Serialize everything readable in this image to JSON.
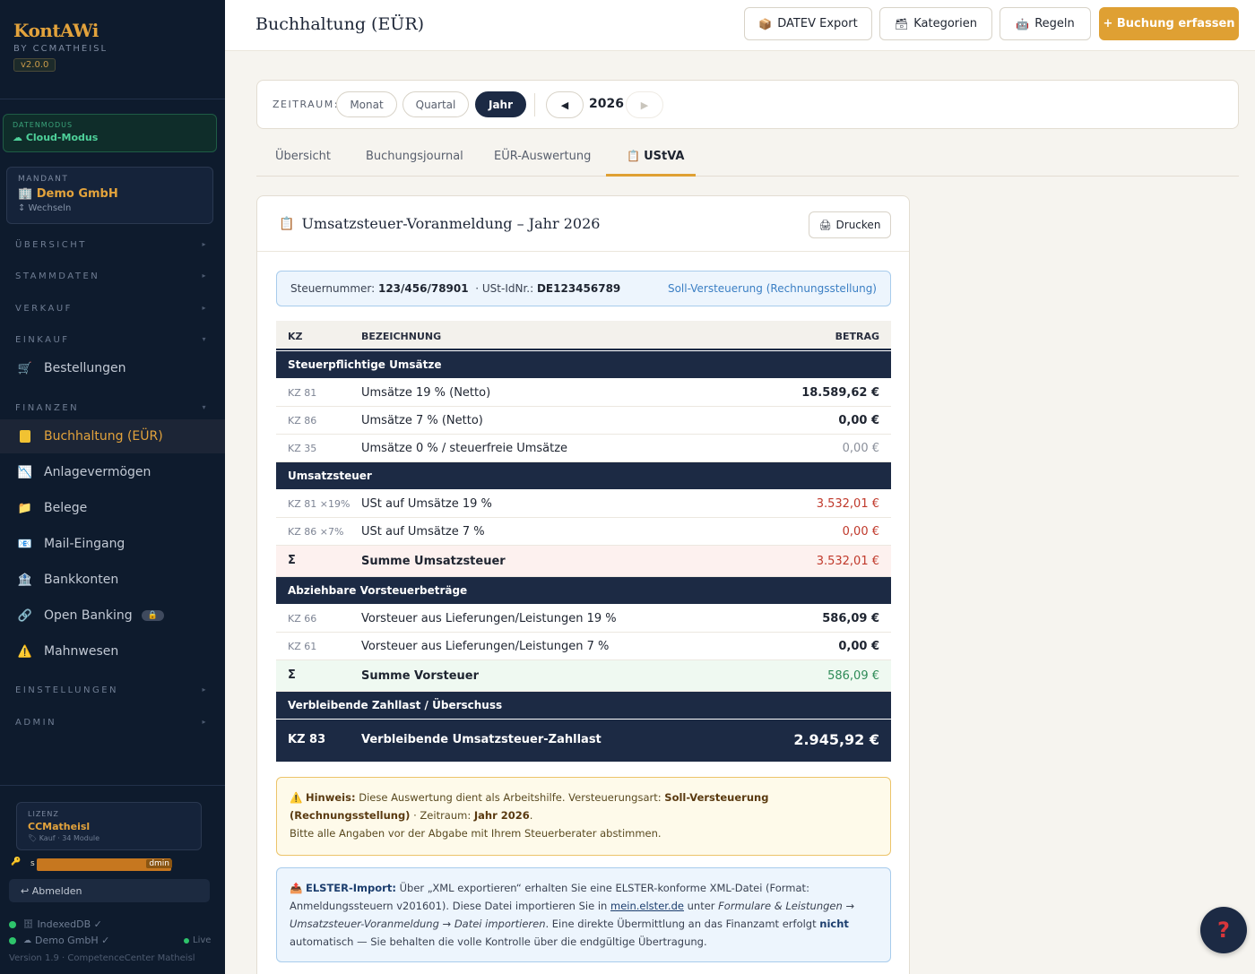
{
  "sidebar": {
    "brand": "KontAWi",
    "by": "BY CCMATHEISL",
    "version": "v2.0.0",
    "datamode": {
      "label": "DATENMODUS",
      "value": "☁ Cloud-Modus"
    },
    "mandant": {
      "label": "MANDANT",
      "name": "Demo GmbH",
      "switch": "↕ Wechseln"
    },
    "sections": {
      "uebersicht": "ÜBERSICHT",
      "stammdaten": "STAMMDATEN",
      "verkauf": "VERKAUF",
      "einkauf": "EINKAUF",
      "finanzen": "FINANZEN",
      "einstellungen": "EINSTELLUNGEN",
      "admin": "ADMIN"
    },
    "items": {
      "bestellungen": "Bestellungen",
      "buchhaltung": "Buchhaltung (EÜR)",
      "anlagevermoegen": "Anlagevermögen",
      "belege": "Belege",
      "mail": "Mail-Eingang",
      "bankkonten": "Bankkonten",
      "openbanking": "Open Banking",
      "mahnwesen": "Mahnwesen"
    },
    "license": {
      "label": "LIZENZ",
      "name": "CCMatheisl",
      "sub": "Kauf · 34 Module"
    },
    "user": {
      "prefix": "s",
      "role": "dmin"
    },
    "logout": "↩ Abmelden",
    "status": {
      "db": "IndexedDB ✓",
      "tenant": "Demo GmbH ✓",
      "live": "Live"
    },
    "footer": "Version 1.9 · CompetenceCenter Matheisl"
  },
  "header": {
    "title": "Buchhaltung (EÜR)",
    "datev": "DATEV Export",
    "kategorien": "Kategorien",
    "regeln": "Regeln",
    "buchung": "+ Buchung erfassen"
  },
  "period": {
    "label": "ZEITRAUM:",
    "monat": "Monat",
    "quartal": "Quartal",
    "jahr": "Jahr",
    "year": "2026"
  },
  "tabs": {
    "uebersicht": "Übersicht",
    "journal": "Buchungsjournal",
    "eur": "EÜR-Auswertung",
    "ustva": "UStVA"
  },
  "report": {
    "title": "Umsatzsteuer-Voranmeldung – Jahr 2026",
    "print": "Drucken",
    "steuernr_label": "Steuernummer:",
    "steuernr": "123/456/78901",
    "ustid_label": "· USt-IdNr.:",
    "ustid": "DE123456789",
    "mode": "Soll-Versteuerung (Rechnungsstellung)",
    "columns": {
      "kz": "KZ",
      "bez": "BEZEICHNUNG",
      "betrag": "BETRAG"
    },
    "sec1": "Steuerpflichtige Umsätze",
    "rows1": [
      {
        "kz": "KZ 81",
        "bez": "Umsätze 19 % (Netto)",
        "amt": "18.589,62 €"
      },
      {
        "kz": "KZ 86",
        "bez": "Umsätze 7 % (Netto)",
        "amt": "0,00 €"
      },
      {
        "kz": "KZ 35",
        "bez": "Umsätze 0 % / steuerfreie Umsätze",
        "amt": "0,00 €"
      }
    ],
    "sec2": "Umsatzsteuer",
    "rows2": [
      {
        "kz": "KZ 81 ×19%",
        "bez": "USt auf Umsätze 19 %",
        "amt": "3.532,01 €"
      },
      {
        "kz": "KZ 86 ×7%",
        "bez": "USt auf Umsätze 7 %",
        "amt": "0,00 €"
      }
    ],
    "sum2": {
      "kz": "Σ",
      "bez": "Summe Umsatzsteuer",
      "amt": "3.532,01 €"
    },
    "sec3": "Abziehbare Vorsteuerbeträge",
    "rows3": [
      {
        "kz": "KZ 66",
        "bez": "Vorsteuer aus Lieferungen/Leistungen 19 %",
        "amt": "586,09 €"
      },
      {
        "kz": "KZ 61",
        "bez": "Vorsteuer aus Lieferungen/Leistungen 7 %",
        "amt": "0,00 €"
      }
    ],
    "sum3": {
      "kz": "Σ",
      "bez": "Summe Vorsteuer",
      "amt": "586,09 €"
    },
    "sec4": "Verbleibende Zahllast / Überschuss",
    "final": {
      "kz": "KZ 83",
      "bez": "Verbleibende Umsatzsteuer-Zahllast",
      "amt": "2.945,92 €"
    }
  },
  "hint": {
    "label": "Hinweis:",
    "t1": " Diese Auswertung dient als Arbeitshilfe. Versteuerungsart: ",
    "mode": "Soll-Versteuerung (Rechnungsstellung)",
    "t2": " · Zeitraum: ",
    "period": "Jahr 2026",
    "t3": ".",
    "line2": "Bitte alle Angaben vor der Abgabe mit Ihrem Steuerberater abstimmen."
  },
  "elster": {
    "label": "ELSTER-Import:",
    "t1": " Über „XML exportieren“ erhalten Sie eine ELSTER-konforme XML-Datei (Format: Anmeldungssteuern v201601). Diese Datei importieren Sie in ",
    "link": "mein.elster.de",
    "t2": " unter ",
    "path": "Formulare & Leistungen → Umsatzsteuer-Voranmeldung → Datei importieren",
    "t3": ". Eine direkte Übermittlung an das Finanzamt erfolgt ",
    "nicht": "nicht",
    "t4": " automatisch — Sie behalten die volle Kontrolle über die endgültige Übertragung."
  },
  "help": "?",
  "colors": {
    "accent": "#dfa033",
    "navy": "#1c2a44",
    "sidebar": "#0e1b2d",
    "red": "#c0392b",
    "green": "#2e8b57"
  }
}
